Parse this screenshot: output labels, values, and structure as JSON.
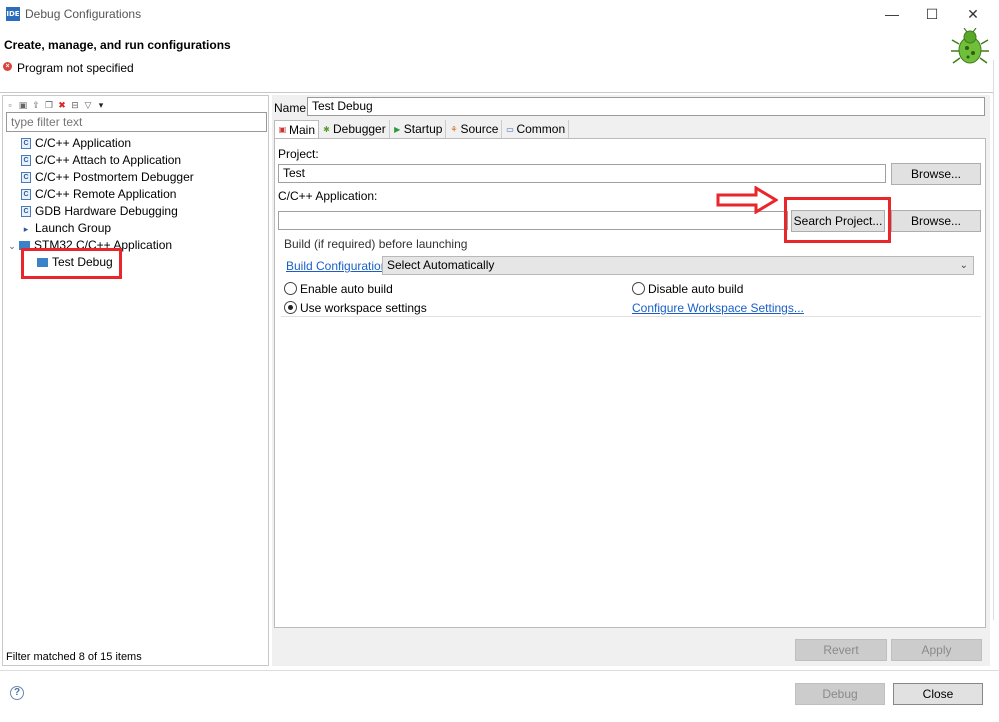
{
  "window": {
    "app_icon_text": "IDE",
    "title": "Debug Configurations",
    "minimize": "—",
    "maximize": "☐",
    "close": "✕"
  },
  "header": {
    "title": "Create, manage, and run configurations",
    "error_message": "Program not specified"
  },
  "left": {
    "filter_placeholder": "type filter text",
    "tree": [
      {
        "label": "C/C++ Application",
        "icon": "c-app-icon"
      },
      {
        "label": "C/C++ Attach to Application",
        "icon": "c-app-icon"
      },
      {
        "label": "C/C++ Postmortem Debugger",
        "icon": "c-app-icon"
      },
      {
        "label": "C/C++ Remote Application",
        "icon": "c-app-icon"
      },
      {
        "label": "GDB Hardware Debugging",
        "icon": "c-app-icon"
      },
      {
        "label": "Launch Group",
        "icon": "launch-group-icon"
      },
      {
        "label": "STM32 C/C++ Application",
        "icon": "ide-icon",
        "expanded": true
      },
      {
        "label": "Test Debug",
        "icon": "ide-icon",
        "child": true,
        "selected": true
      }
    ],
    "status": "Filter matched 8 of 15 items"
  },
  "right": {
    "name_label": "Name:",
    "name_value": "Test  Debug",
    "tabs": [
      {
        "label": "Main",
        "active": true
      },
      {
        "label": "Debugger"
      },
      {
        "label": "Startup"
      },
      {
        "label": "Source"
      },
      {
        "label": "Common"
      }
    ],
    "project_label": "Project:",
    "project_value": "Test",
    "browse_label": "Browse...",
    "app_label": "C/C++ Application:",
    "app_value": "",
    "search_project_label": "Search Project...",
    "build_group_title": "Build (if required) before launching",
    "build_config_link": "Build Configuration:",
    "build_config_value": "Select Automatically",
    "enable_auto_build": "Enable auto build",
    "disable_auto_build": "Disable auto build",
    "use_workspace": "Use workspace settings",
    "configure_workspace_link": "Configure Workspace Settings...",
    "revert_label": "Revert",
    "apply_label": "Apply"
  },
  "footer": {
    "help_icon": "?",
    "debug_label": "Debug",
    "close_label": "Close"
  },
  "colors": {
    "annotation_red": "#e8262b",
    "link_blue": "#1a5fc8"
  }
}
